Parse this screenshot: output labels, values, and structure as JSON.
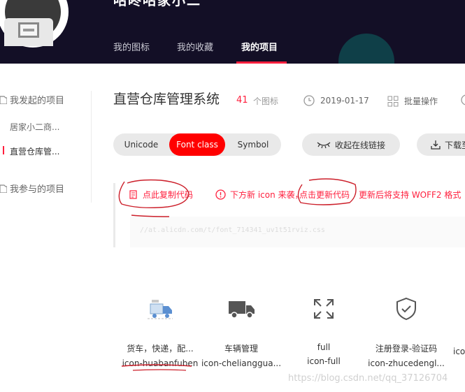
{
  "header": {
    "title": "咕咚咕家小二",
    "tabs": [
      "我的图标",
      "我的收藏",
      "我的项目"
    ],
    "active_tab": 2
  },
  "sidebar": {
    "group1": "我发起的项目",
    "items": [
      "居家小二商...",
      "直营仓库管..."
    ],
    "group2": "我参与的项目"
  },
  "project": {
    "title": "直营仓库管理系统",
    "count": "41",
    "count_unit": "个图标",
    "date": "2019-01-17",
    "batch_label": "批量操作"
  },
  "formats": [
    "Unicode",
    "Font class",
    "Symbol"
  ],
  "active_format": 1,
  "actions": {
    "collapse_link": "收起在线链接",
    "download": "下载至"
  },
  "code": {
    "copy_label": "点此复制代码",
    "notice_pre": "下方新 icon 来袭，",
    "update_link": "点击更新代码",
    "notice_post": "更新后将支持 WOFF2 格式",
    "url": "//at.alicdn.com/t/font_714341_uv1t51rviz.css"
  },
  "icons": [
    {
      "name": "货车，快递，配...",
      "code": "icon-huabanfuben",
      "glyph": "delivery-truck-icon"
    },
    {
      "name": "车辆管理",
      "code": "icon-cheliangguа...",
      "glyph": "truck-icon"
    },
    {
      "name": "full",
      "code": "icon-full",
      "glyph": "fullscreen-icon"
    },
    {
      "name": "注册登录-验证码",
      "code": "icon-zhucedengl...",
      "glyph": "shield-check-icon"
    },
    {
      "name": "",
      "code": "ico",
      "glyph": ""
    }
  ],
  "watermark": "https://blog.csdn.net/qq_37126704",
  "colors": {
    "header_bg": "#130f26",
    "accent": "#ff1f3d",
    "annotation": "#cc1f2a"
  }
}
